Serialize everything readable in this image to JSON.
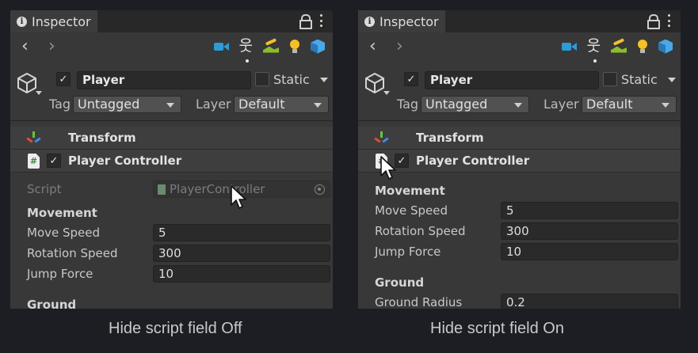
{
  "panels": [
    {
      "tab_title": "Inspector",
      "object": {
        "name": "Player",
        "static_label": "Static",
        "tag_label": "Tag",
        "tag_value": "Untagged",
        "layer_label": "Layer",
        "layer_value": "Default"
      },
      "components": {
        "transform": "Transform",
        "player_controller": "Player Controller"
      },
      "script": {
        "label": "Script",
        "value": "PlayerController"
      },
      "movement": {
        "header": "Movement",
        "props": [
          {
            "label": "Move Speed",
            "value": "5"
          },
          {
            "label": "Rotation Speed",
            "value": "300"
          },
          {
            "label": "Jump Force",
            "value": "10"
          }
        ]
      },
      "ground": {
        "header": "Ground"
      },
      "caption": "Hide script field Off"
    },
    {
      "tab_title": "Inspector",
      "object": {
        "name": "Player",
        "static_label": "Static",
        "tag_label": "Tag",
        "tag_value": "Untagged",
        "layer_label": "Layer",
        "layer_value": "Default"
      },
      "components": {
        "transform": "Transform",
        "player_controller": "Player Controller"
      },
      "movement": {
        "header": "Movement",
        "props": [
          {
            "label": "Move Speed",
            "value": "5"
          },
          {
            "label": "Rotation Speed",
            "value": "300"
          },
          {
            "label": "Jump Force",
            "value": "10"
          }
        ]
      },
      "ground": {
        "header": "Ground",
        "props": [
          {
            "label": "Ground Radius",
            "value": "0.2"
          }
        ]
      },
      "caption": "Hide script field On"
    }
  ],
  "icons": {
    "nav_back": "‹",
    "nav_forward": "›",
    "check": "✓",
    "hash": "#",
    "avatar": "웃"
  },
  "colors": {
    "background": "#1c1e24",
    "panel": "#383838",
    "tabbar": "#282828",
    "field": "#2a2a2a",
    "camera_icon": "#2e9bd6",
    "bulb_icon": "#f5c025",
    "terrain_icon": "#8cbc2c"
  }
}
